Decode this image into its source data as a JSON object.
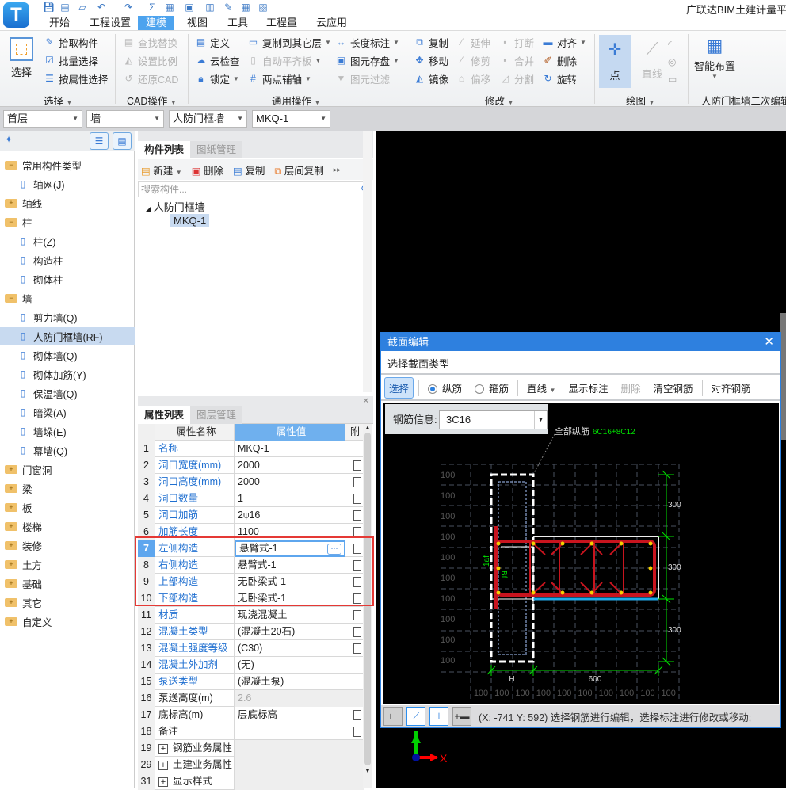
{
  "app": {
    "title": "广联达BIM土建计量平台",
    "logo_letter": "T"
  },
  "quick_access": [
    "save-icon",
    "new-file-icon",
    "open-folder-icon",
    "undo-icon",
    "redo-icon",
    "sum-icon",
    "report-icon",
    "search-report-icon",
    "calc-icon",
    "pen-icon",
    "grid-icon",
    "add-file-icon"
  ],
  "menu_tabs": [
    {
      "label": "开始"
    },
    {
      "label": "工程设置"
    },
    {
      "label": "建模",
      "active": true
    },
    {
      "label": "视图"
    },
    {
      "label": "工具"
    },
    {
      "label": "工程量"
    },
    {
      "label": "云应用"
    }
  ],
  "ribbon": {
    "select": {
      "big_label": "选择",
      "items": [
        "拾取构件",
        "批量选择",
        "按属性选择"
      ],
      "group": "选择"
    },
    "cad": {
      "items": [
        "查找替换",
        "设置比例",
        "还原CAD"
      ],
      "group": "CAD操作"
    },
    "general": {
      "col1": [
        "定义",
        "云检查",
        "锁定"
      ],
      "col2": [
        "复制到其它层",
        "自动平齐板",
        "两点辅轴"
      ],
      "col3": [
        "长度标注",
        "图元存盘",
        "图元过滤"
      ],
      "group": "通用操作"
    },
    "modify": {
      "col1": [
        "复制",
        "移动",
        "镜像"
      ],
      "col2": [
        "延伸",
        "修剪",
        "偏移"
      ],
      "col3": [
        "打断",
        "合并",
        "分割"
      ],
      "col4": [
        "对齐",
        "删除",
        "旋转"
      ],
      "group": "修改"
    },
    "draw": {
      "point": "点",
      "line": "直线",
      "group": "绘图"
    },
    "smart": {
      "label": "智能布置",
      "group": "人防门框墙二次编辑"
    }
  },
  "selectors": [
    "首层",
    "墙",
    "人防门框墙",
    "MKQ-1"
  ],
  "tree": [
    {
      "label": "常用构件类型",
      "type": "folder",
      "open": true
    },
    {
      "label": "轴网(J)",
      "type": "child",
      "icon": "axis-grid-icon"
    },
    {
      "label": "轴线",
      "type": "folder"
    },
    {
      "label": "柱",
      "type": "folder",
      "open": true
    },
    {
      "label": "柱(Z)",
      "type": "child",
      "icon": "column-icon"
    },
    {
      "label": "构造柱",
      "type": "child",
      "icon": "constructional-column-icon"
    },
    {
      "label": "砌体柱",
      "type": "child",
      "icon": "masonry-column-icon"
    },
    {
      "label": "墙",
      "type": "folder",
      "open": true
    },
    {
      "label": "剪力墙(Q)",
      "type": "child",
      "icon": "shear-wall-icon"
    },
    {
      "label": "人防门框墙(RF)",
      "type": "child",
      "icon": "door-frame-wall-icon",
      "selected": true
    },
    {
      "label": "砌体墙(Q)",
      "type": "child",
      "icon": "masonry-wall-icon"
    },
    {
      "label": "砌体加筋(Y)",
      "type": "child",
      "icon": "masonry-rebar-icon"
    },
    {
      "label": "保温墙(Q)",
      "type": "child",
      "icon": "insulation-wall-icon"
    },
    {
      "label": "暗梁(A)",
      "type": "child",
      "icon": "hidden-beam-icon"
    },
    {
      "label": "墙垛(E)",
      "type": "child",
      "icon": "wall-pier-icon"
    },
    {
      "label": "幕墙(Q)",
      "type": "child",
      "icon": "curtain-wall-icon"
    },
    {
      "label": "门窗洞",
      "type": "folder"
    },
    {
      "label": "梁",
      "type": "folder"
    },
    {
      "label": "板",
      "type": "folder"
    },
    {
      "label": "楼梯",
      "type": "folder"
    },
    {
      "label": "装修",
      "type": "folder"
    },
    {
      "label": "土方",
      "type": "folder"
    },
    {
      "label": "基础",
      "type": "folder"
    },
    {
      "label": "其它",
      "type": "folder"
    },
    {
      "label": "自定义",
      "type": "folder"
    }
  ],
  "component_panel": {
    "tabs": [
      "构件列表",
      "图纸管理"
    ],
    "toolbar": [
      "新建",
      "删除",
      "复制",
      "层间复制"
    ],
    "search_placeholder": "搜索构件...",
    "group": "人防门框墙",
    "item": "MKQ-1"
  },
  "property_panel": {
    "tabs": [
      "属性列表",
      "图层管理"
    ],
    "headers": [
      "属性名称",
      "属性值",
      "附"
    ],
    "rows": [
      {
        "n": "1",
        "name": "名称",
        "value": "MKQ-1",
        "link": true,
        "check": false
      },
      {
        "n": "2",
        "name": "洞口宽度(mm)",
        "value": "2000",
        "link": true,
        "check": true
      },
      {
        "n": "3",
        "name": "洞口高度(mm)",
        "value": "2000",
        "link": true,
        "check": true
      },
      {
        "n": "4",
        "name": "洞口数量",
        "value": "1",
        "link": true,
        "check": true
      },
      {
        "n": "5",
        "name": "洞口加筋",
        "value": "2⍦16",
        "link": true,
        "check": true
      },
      {
        "n": "6",
        "name": "加筋长度",
        "value": "1100",
        "link": true,
        "check": true
      },
      {
        "n": "7",
        "name": "左侧构造",
        "value": "悬臂式-1",
        "link": true,
        "check": true,
        "editing": true
      },
      {
        "n": "8",
        "name": "右侧构造",
        "value": "悬臂式-1",
        "link": true,
        "check": true
      },
      {
        "n": "9",
        "name": "上部构造",
        "value": "无卧梁式-1",
        "link": true,
        "check": true
      },
      {
        "n": "10",
        "name": "下部构造",
        "value": "无卧梁式-1",
        "link": true,
        "check": true
      },
      {
        "n": "11",
        "name": "材质",
        "value": "现浇混凝土",
        "link": true,
        "check": true
      },
      {
        "n": "12",
        "name": "混凝土类型",
        "value": "(混凝土20石)",
        "link": true,
        "check": true
      },
      {
        "n": "13",
        "name": "混凝土强度等级",
        "value": "(C30)",
        "link": true,
        "check": true
      },
      {
        "n": "14",
        "name": "混凝土外加剂",
        "value": "(无)",
        "link": true,
        "check": false
      },
      {
        "n": "15",
        "name": "泵送类型",
        "value": "(混凝土泵)",
        "link": true,
        "check": false
      },
      {
        "n": "16",
        "name": "泵送高度(m)",
        "value": "2.6",
        "link": false,
        "check": false,
        "readonly": true
      },
      {
        "n": "17",
        "name": "底标高(m)",
        "value": "层底标高",
        "link": false,
        "check": true
      },
      {
        "n": "18",
        "name": "备注",
        "value": "",
        "link": false,
        "check": true
      },
      {
        "n": "19",
        "name": "钢筋业务属性",
        "value": "",
        "link": false,
        "group": true
      },
      {
        "n": "29",
        "name": "土建业务属性",
        "value": "",
        "link": false,
        "group": true
      },
      {
        "n": "31",
        "name": "显示样式",
        "value": "",
        "link": false,
        "group": true
      }
    ],
    "highlight_rows": [
      "7",
      "8",
      "9",
      "10"
    ]
  },
  "dialog": {
    "title": "截面编辑",
    "section_type_button": "选择截面类型",
    "toolbar": {
      "select": "选择",
      "radio_long": "纵筋",
      "radio_stirrup": "箍筋",
      "line": "直线",
      "show_dim": "显示标注",
      "delete": "删除",
      "clear": "清空钢筋",
      "align": "对齐钢筋"
    },
    "rebar_info_label": "钢筋信息:",
    "rebar_info_value": "3C16",
    "annotation_label": "全部纵筋",
    "annotation_value": "6C16+8C12",
    "grid_label": "100",
    "dim_vertical": [
      "300",
      "300",
      "300"
    ],
    "dim_h": "H",
    "dim_600": "600",
    "side_text_1": "1af",
    "side_text_2": "Bf",
    "status": "(X: -741 Y: 592)  选择钢筋进行编辑，选择标注进行修改或移动;"
  },
  "axis": {
    "x_label": "X"
  },
  "colors": {
    "accent": "#2e80df",
    "rebar": "#c8141e",
    "dimension": "#00e000",
    "highlight_box": "#e53935"
  }
}
